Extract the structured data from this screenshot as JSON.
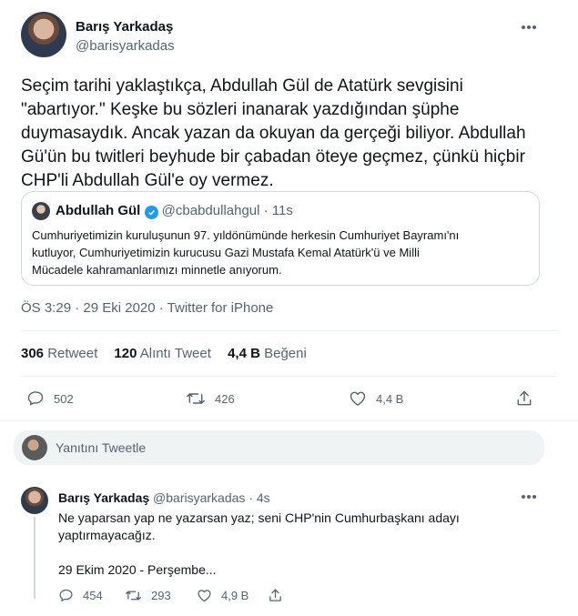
{
  "main_tweet": {
    "author_name": "Barış Yarkadaş",
    "author_handle": "@barisyarkadas",
    "lines": [
      "Seçim tarihi yaklaştıkça, Abdullah Gül de Atatürk sevgisini",
      "\"abartıyor.\" Keşke bu sözleri inanarak yazdığından şüphe",
      "duymasaydık. Ancak yazan da okuyan da gerçeği biliyor. Abdullah",
      "Gü'ün bu twitleri beyhude bir çabadan öteye geçmez, çünkü hiçbir",
      "CHP'li Abdullah Gül'e oy vermez."
    ],
    "meta": "ÖS 3:29 · 29 Eki 2020 · Twitter for iPhone",
    "stats": {
      "retweet_count": "306",
      "retweet_label": "Retweet",
      "quote_count": "120",
      "quote_label": "Alıntı Tweet",
      "like_count": "4,4 B",
      "like_label": "Beğeni"
    },
    "actions": {
      "reply": "502",
      "retweet": "426",
      "like": "4,4 B"
    }
  },
  "quoted_tweet": {
    "author_name": "Abdullah Gül",
    "author_handle": "@cbabdullahgul",
    "time": "· 11s",
    "lines": [
      "Cumhuriyetimizin kuruluşunun 97. yıldönümünde herkesin Cumhuriyet Bayramı'nı",
      "kutluyor, Cumhuriyetimizin kurucusu Gazi Mustafa Kemal Atatürk'ü ve Milli",
      "Mücadele kahramanlarımızı minnetle anıyorum."
    ]
  },
  "reply_composer": {
    "placeholder": "Yanıtını Tweetle"
  },
  "reply_tweet": {
    "author_name": "Barış Yarkadaş",
    "author_handle": "@barisyarkadas",
    "time": "· 4s",
    "lines": [
      "Ne yaparsan yap ne yazarsan yaz; seni CHP'nin Cumhurbaşkanı adayı",
      "yaptırmayacağız."
    ],
    "extra": "29 Ekim 2020 - Perşembe...",
    "actions": {
      "reply": "454",
      "retweet": "293",
      "like": "4,9 B"
    }
  },
  "colors": {
    "accent": "#1d9bf0",
    "text": "#0f1419",
    "secondary": "#536471",
    "border": "#cfd9de"
  }
}
